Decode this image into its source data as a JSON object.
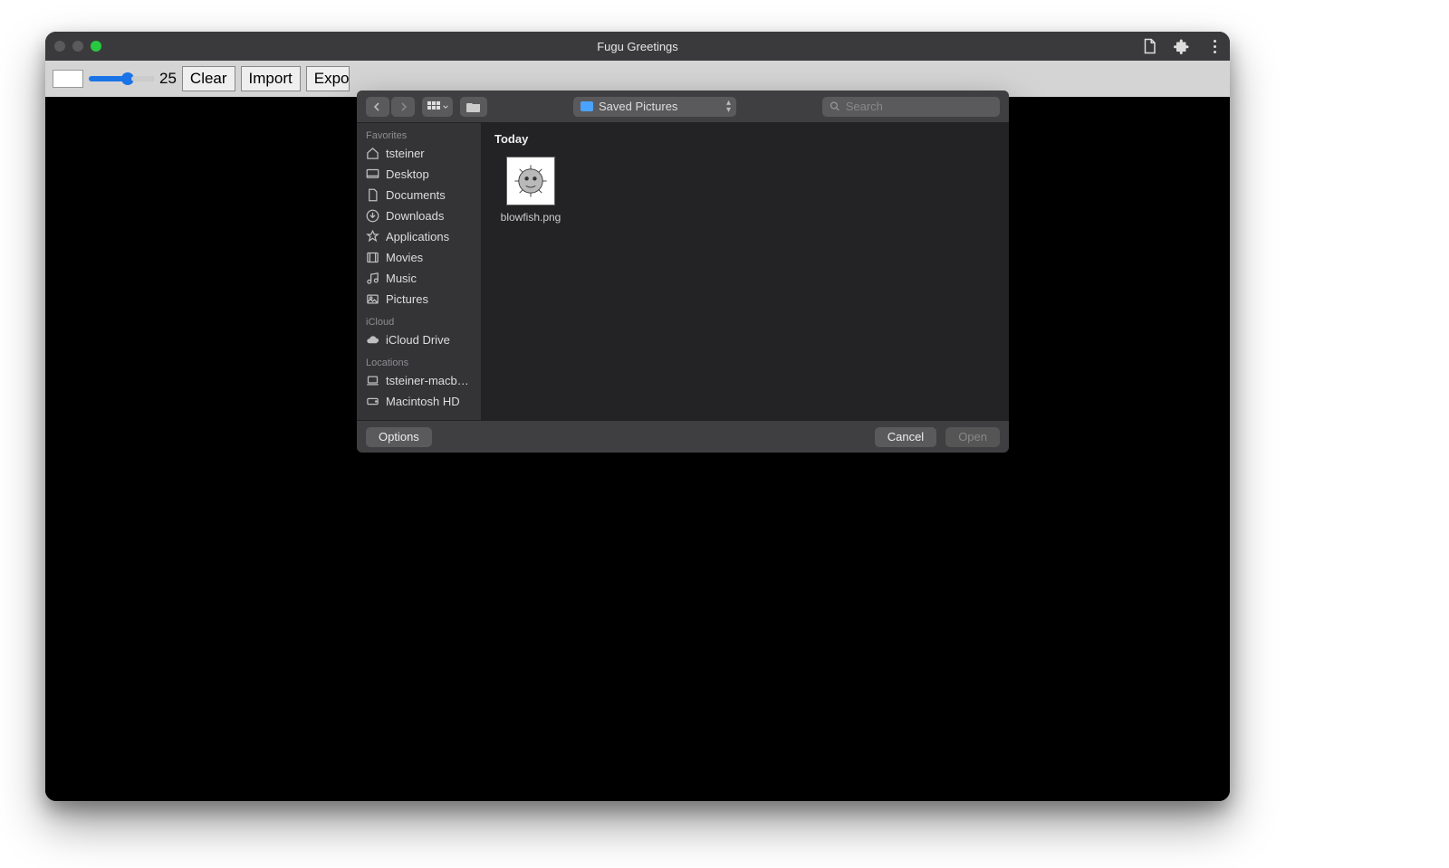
{
  "window": {
    "title": "Fugu Greetings"
  },
  "toolbar": {
    "slider_value": "25",
    "clear_label": "Clear",
    "import_label": "Import",
    "export_label": "Export"
  },
  "dialog": {
    "location": "Saved Pictures",
    "search_placeholder": "Search",
    "options_label": "Options",
    "cancel_label": "Cancel",
    "open_label": "Open",
    "today_label": "Today",
    "sidebar": {
      "favorites_label": "Favorites",
      "favorites": [
        {
          "label": "tsteiner",
          "icon": "home"
        },
        {
          "label": "Desktop",
          "icon": "desktop"
        },
        {
          "label": "Documents",
          "icon": "doc"
        },
        {
          "label": "Downloads",
          "icon": "download"
        },
        {
          "label": "Applications",
          "icon": "apps"
        },
        {
          "label": "Movies",
          "icon": "movies"
        },
        {
          "label": "Music",
          "icon": "music"
        },
        {
          "label": "Pictures",
          "icon": "pictures"
        }
      ],
      "icloud_label": "iCloud",
      "icloud": [
        {
          "label": "iCloud Drive",
          "icon": "cloud"
        }
      ],
      "locations_label": "Locations",
      "locations": [
        {
          "label": "tsteiner-macb…",
          "icon": "laptop"
        },
        {
          "label": "Macintosh HD",
          "icon": "disk"
        }
      ]
    },
    "files": [
      {
        "name": "blowfish.png"
      }
    ]
  }
}
